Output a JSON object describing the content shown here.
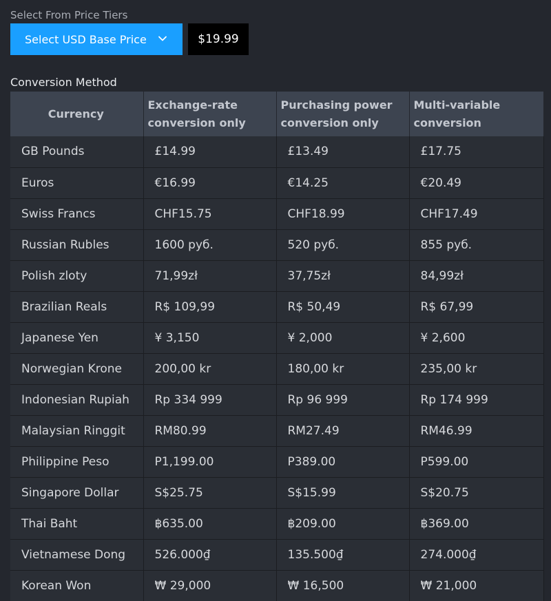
{
  "tiers": {
    "label": "Select From Price Tiers",
    "select_label": "Select USD Base Price",
    "selected_price": "$19.99"
  },
  "conversion": {
    "label": "Conversion Method",
    "headers": [
      "Currency",
      "Exchange-rate conversion only",
      "Purchasing power conversion only",
      "Multi-variable conversion"
    ],
    "rows": [
      [
        "GB Pounds",
        "£14.99",
        "£13.49",
        "£17.75"
      ],
      [
        "Euros",
        "€16.99",
        "€14.25",
        "€20.49"
      ],
      [
        "Swiss Francs",
        "CHF15.75",
        "CHF18.99",
        "CHF17.49"
      ],
      [
        "Russian Rubles",
        "1600 руб.",
        "520 руб.",
        "855 руб."
      ],
      [
        "Polish zloty",
        "71,99zł",
        "37,75zł",
        "84,99zł"
      ],
      [
        "Brazilian Reals",
        "R$ 109,99",
        "R$ 50,49",
        "R$ 67,99"
      ],
      [
        "Japanese Yen",
        "¥ 3,150",
        "¥ 2,000",
        "¥ 2,600"
      ],
      [
        "Norwegian Krone",
        "200,00 kr",
        "180,00 kr",
        "235,00 kr"
      ],
      [
        "Indonesian Rupiah",
        "Rp 334 999",
        "Rp 96 999",
        "Rp 174 999"
      ],
      [
        "Malaysian Ringgit",
        "RM80.99",
        "RM27.49",
        "RM46.99"
      ],
      [
        "Philippine Peso",
        "P1,199.00",
        "P389.00",
        "P599.00"
      ],
      [
        "Singapore Dollar",
        "S$25.75",
        "S$15.99",
        "S$20.75"
      ],
      [
        "Thai Baht",
        "฿635.00",
        "฿209.00",
        "฿369.00"
      ],
      [
        "Vietnamese Dong",
        "526.000₫",
        "135.500₫",
        "274.000₫"
      ],
      [
        "Korean Won",
        "₩ 29,000",
        "₩ 16,500",
        "₩ 21,000"
      ]
    ]
  },
  "icons": {
    "dropdown": "chevron-down-icon"
  },
  "colors": {
    "accent": "#1a9fff",
    "background": "#24272e",
    "header": "#3d4450"
  }
}
